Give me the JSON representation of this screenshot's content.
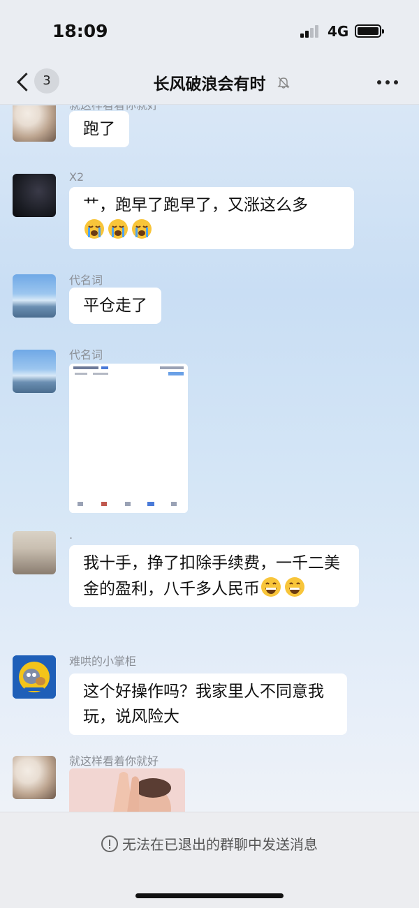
{
  "status_bar": {
    "time": "18:09",
    "network": "4G"
  },
  "nav": {
    "back_badge": "3",
    "title": "长风破浪会有时"
  },
  "messages": [
    {
      "sender": "就这样看着你就好",
      "text": "跑了"
    },
    {
      "sender": "X2",
      "text": "艹，跑早了跑早了，又涨这么多"
    },
    {
      "sender": "代名词",
      "text": "平仓走了"
    },
    {
      "sender": "代名词",
      "type": "image"
    },
    {
      "sender": ".",
      "text": "我十手，挣了扣除手续费，一千二美金的盈利，八千多人民币"
    },
    {
      "sender": "难哄的小掌柜",
      "text": "这个好操作吗？我家里人不同意我玩，说风险大"
    },
    {
      "sender": "就这样看着你就好",
      "type": "sticker"
    }
  ],
  "footer": {
    "notice": "无法在已退出的群聊中发送消息"
  },
  "icons": {
    "back": "chevron-left-icon",
    "mute": "bell-off-icon",
    "more": "ellipsis-icon",
    "emoji_cry": "loudly-crying-face-icon",
    "emoji_grin": "grinning-face-icon",
    "info": "info-circle-icon"
  },
  "colors": {
    "bubble": "#ffffff",
    "sender_text": "#8b8f96",
    "nav_bg": "#eaedf2"
  }
}
